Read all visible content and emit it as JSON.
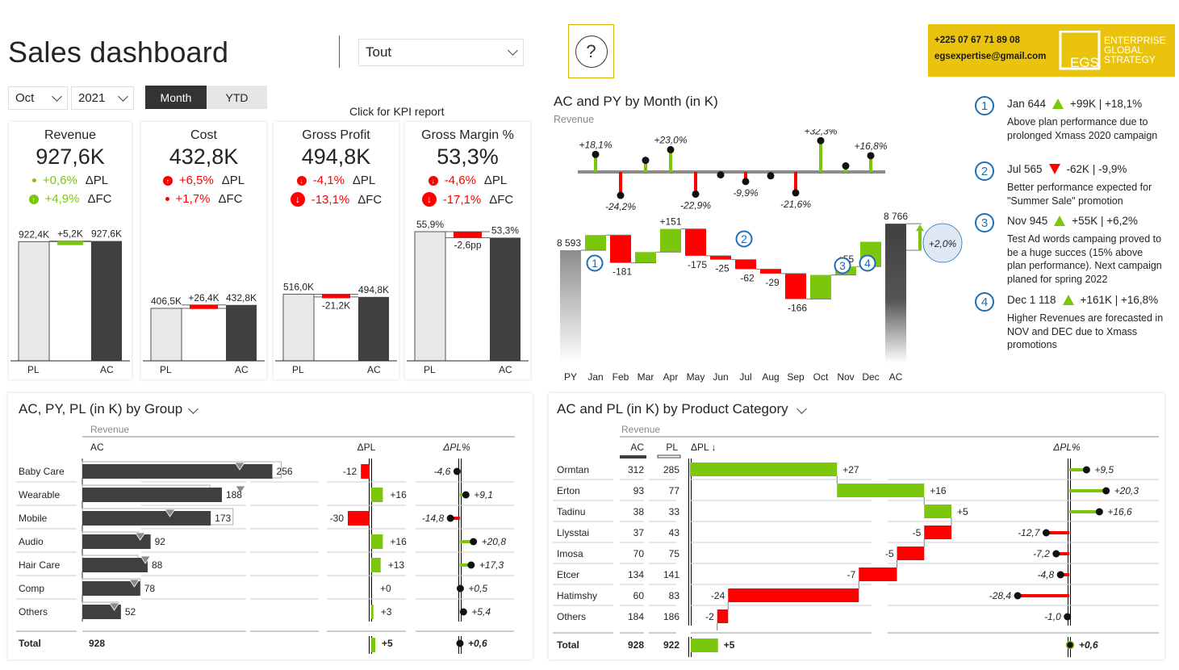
{
  "header": {
    "title": "Sales dashboard",
    "filter_dropdown": "Tout",
    "month_select": "Oct",
    "year_select": "2021",
    "period_toggle": [
      {
        "label": "Month",
        "active": true
      },
      {
        "label": "YTD",
        "active": false
      }
    ],
    "help_icon": "?",
    "kpi_link": "Click for KPI report"
  },
  "brand": {
    "phone": "+225 07 67 71 89 08",
    "email": "egsexpertise@gmail.com",
    "logo_initials": "EGS",
    "logo_line1": "ENTERPRISE",
    "logo_line2": "GLOBAL",
    "logo_line3": "STRATEGY",
    "color": "#EAC30F"
  },
  "colors": {
    "positive": "#7AC70C",
    "negative": "#FF0000",
    "ac": "#404040",
    "pl": "#E8E8E8",
    "annotation": "#1F6EB5"
  },
  "kpi_cards": [
    {
      "title": "Revenue",
      "value": "927,6K",
      "delta_pl": "+0,6%",
      "delta_pl_label": "ΔPL",
      "delta_pl_good": true,
      "delta_pl_icon": "dot-small",
      "delta_fc": "+4,9%",
      "delta_fc_label": "ΔFC",
      "delta_fc_good": true,
      "delta_fc_icon": "arrow-up-circle",
      "chart": {
        "pl": 922.4,
        "ac": 927.6,
        "diff": 5.2,
        "pl_label": "922,4K",
        "ac_label": "927,6K",
        "diff_label": "+5,2K",
        "diff_good": true,
        "scale_max": 1000
      },
      "x_labels": [
        "PL",
        "AC"
      ]
    },
    {
      "title": "Cost",
      "value": "432,8K",
      "delta_pl": "+6,5%",
      "delta_pl_label": "ΔPL",
      "delta_pl_good": false,
      "delta_pl_icon": "arrow-up-circle",
      "delta_fc": "+1,7%",
      "delta_fc_label": "ΔFC",
      "delta_fc_good": false,
      "delta_fc_icon": "dot-small",
      "chart": {
        "pl": 406.5,
        "ac": 432.8,
        "diff": 26.4,
        "pl_label": "406,5K",
        "ac_label": "432,8K",
        "diff_label": "+26,4K",
        "diff_good": false,
        "scale_max": 1000
      },
      "x_labels": [
        "PL",
        "AC"
      ]
    },
    {
      "title": "Gross Profit",
      "value": "494,8K",
      "delta_pl": "-4,1%",
      "delta_pl_label": "ΔPL",
      "delta_pl_good": false,
      "delta_pl_icon": "arrow-down-circle",
      "delta_fc": "-13,1%",
      "delta_fc_label": "ΔFC",
      "delta_fc_good": false,
      "delta_fc_icon": "arrow-down-circle-large",
      "chart": {
        "pl": 516.0,
        "ac": 494.8,
        "diff": -21.2,
        "pl_label": "516,0K",
        "ac_label": "494,8K",
        "diff_label": "-21,2K",
        "diff_good": false,
        "scale_max": 1000
      },
      "x_labels": [
        "PL",
        "AC"
      ]
    },
    {
      "title": "Gross Margin %",
      "value": "53,3%",
      "delta_pl": "-4,6%",
      "delta_pl_label": "ΔPL",
      "delta_pl_good": false,
      "delta_pl_icon": "arrow-down-circle",
      "delta_fc": "-17,1%",
      "delta_fc_label": "ΔFC",
      "delta_fc_good": false,
      "delta_fc_icon": "arrow-down-circle-large",
      "chart": {
        "pl": 55.9,
        "ac": 53.3,
        "diff": -2.6,
        "pl_label": "55,9%",
        "ac_label": "53,3%",
        "diff_label": "-2,6pp",
        "diff_good": false,
        "scale_max": 60
      },
      "x_labels": [
        "PL",
        "AC"
      ]
    }
  ],
  "monthly_chart": {
    "title": "AC and PY by Month (in K)",
    "subtitle": "Revenue",
    "chart_data": {
      "type": "waterfall",
      "categories": [
        "PY",
        "Jan",
        "Feb",
        "Mar",
        "Apr",
        "May",
        "Jun",
        "Jul",
        "Aug",
        "Sep",
        "Oct",
        "Nov",
        "Dec",
        "AC"
      ],
      "py_total": 8593,
      "py_total_label": "8 593",
      "ac_total": 8766,
      "ac_total_label": "8 766",
      "deltas": [
        99,
        -181,
        70,
        151,
        -175,
        -25,
        -62,
        -29,
        -166,
        157,
        55,
        161
      ],
      "delta_labels": [
        "",
        "-181",
        "",
        "+151",
        "-175",
        "-25",
        "-62",
        "-29",
        "-166",
        "",
        "+55",
        ""
      ],
      "delta_pct": [
        18.1,
        -24.2,
        12.0,
        23.0,
        -22.9,
        -3.0,
        -9.9,
        -4.0,
        -21.6,
        32.3,
        6.2,
        16.8
      ],
      "delta_pct_labels": [
        "+18,1%",
        "-24,2%",
        "",
        "+23,0%",
        "-22,9%",
        "",
        "-9,9%",
        "",
        "-21,6%",
        "+32,3%",
        "",
        "+16,8%"
      ],
      "total_change_label": "+2,0%",
      "annotations": [
        {
          "n": "1",
          "month": "Jan"
        },
        {
          "n": "2",
          "month": "Jul"
        },
        {
          "n": "3",
          "month": "Nov"
        },
        {
          "n": "4",
          "month": "Dec"
        }
      ]
    }
  },
  "notes": [
    {
      "n": "1",
      "head": "Jan 644",
      "dir": "up",
      "delta": "+99K | +18,1%",
      "text": "Above plan performance due to prolonged Xmass 2020 campaign"
    },
    {
      "n": "2",
      "head": "Jul 565",
      "dir": "down",
      "delta": "-62K | -9,9%",
      "text": "Better performance expected for \"Summer Sale\" promotion"
    },
    {
      "n": "3",
      "head": "Nov 945",
      "dir": "up",
      "delta": "+55K | +6,2%",
      "text": "Test Ad words campaing proved to be a huge succes (15% above plan performance). Next campaign planed for spring 2022"
    },
    {
      "n": "4",
      "head": "Dec 1 118",
      "dir": "up",
      "delta": "+161K | +16,8%",
      "text": "Higher Revenues are forecasted in NOV and DEC due to Xmass promotions"
    }
  ],
  "group_table": {
    "title": "AC, PY, PL (in K) by Group",
    "subtitle": "Revenue",
    "col_ac": "AC",
    "col_dpl": "ΔPL",
    "col_dplpct": "ΔPL%",
    "total_label": "Total",
    "total_ac": "928",
    "total_dpl": 5,
    "total_dpl_label": "+5",
    "total_dplpct": 0.6,
    "total_dplpct_label": "+0,6",
    "chart_data": {
      "type": "bar",
      "rows": [
        {
          "name": "Baby Care",
          "ac": 256,
          "pl": 268,
          "py": 212,
          "dpl": -12,
          "dpl_label": "-12",
          "dplpct": -4.6,
          "dplpct_label": "-4,6"
        },
        {
          "name": "Wearable",
          "ac": 188,
          "pl": 172,
          "py": 213,
          "dpl": 16,
          "dpl_label": "+16",
          "dplpct": 9.1,
          "dplpct_label": "+9,1"
        },
        {
          "name": "Mobile",
          "ac": 173,
          "pl": 203,
          "py": 118,
          "dpl": -30,
          "dpl_label": "-30",
          "dplpct": -14.8,
          "dplpct_label": "-14,8"
        },
        {
          "name": "Audio",
          "ac": 92,
          "pl": 76,
          "py": 78,
          "dpl": 16,
          "dpl_label": "+16",
          "dplpct": 20.8,
          "dplpct_label": "+20,8"
        },
        {
          "name": "Hair Care",
          "ac": 88,
          "pl": 75,
          "py": 85,
          "dpl": 13,
          "dpl_label": "+13",
          "dplpct": 17.3,
          "dplpct_label": "+17,3"
        },
        {
          "name": "Comp",
          "ac": 78,
          "pl": 78,
          "py": 70,
          "dpl": 0,
          "dpl_label": "+0",
          "dplpct": 0.5,
          "dplpct_label": "+0,5"
        },
        {
          "name": "Others",
          "ac": 52,
          "pl": 49,
          "py": 43,
          "dpl": 3,
          "dpl_label": "+3",
          "dplpct": 5.4,
          "dplpct_label": "+5,4"
        }
      ]
    }
  },
  "category_table": {
    "title": "AC and PL (in K) by Product Category",
    "subtitle": "Revenue",
    "col_ac": "AC",
    "col_pl": "PL",
    "col_dpl": "ΔPL ↓",
    "col_dplpct": "ΔPL%",
    "total_label": "Total",
    "total_ac": "928",
    "total_pl": "922",
    "total_dpl": 5,
    "total_dpl_label": "+5",
    "total_dplpct": 0.6,
    "total_dplpct_label": "+0,6",
    "chart_data": {
      "type": "waterfall",
      "rows": [
        {
          "name": "Ormtan",
          "ac": "312",
          "pl": "285",
          "dpl": 27,
          "dpl_label": "+27",
          "dplpct": 9.5,
          "dplpct_label": "+9,5"
        },
        {
          "name": "Erton",
          "ac": "93",
          "pl": "77",
          "dpl": 16,
          "dpl_label": "+16",
          "dplpct": 20.3,
          "dplpct_label": "+20,3"
        },
        {
          "name": "Tadinu",
          "ac": "38",
          "pl": "33",
          "dpl": 5,
          "dpl_label": "+5",
          "dplpct": 16.6,
          "dplpct_label": "+16,6"
        },
        {
          "name": "Llysstai",
          "ac": "37",
          "pl": "43",
          "dpl": -5,
          "dpl_label": "-5",
          "dplpct": -12.7,
          "dplpct_label": "-12,7"
        },
        {
          "name": "Imosa",
          "ac": "70",
          "pl": "75",
          "dpl": -5,
          "dpl_label": "-5",
          "dplpct": -7.2,
          "dplpct_label": "-7,2"
        },
        {
          "name": "Etcer",
          "ac": "134",
          "pl": "141",
          "dpl": -7,
          "dpl_label": "-7",
          "dplpct": -4.8,
          "dplpct_label": "-4,8"
        },
        {
          "name": "Hatimshy",
          "ac": "60",
          "pl": "83",
          "dpl": -24,
          "dpl_label": "-24",
          "dplpct": -28.4,
          "dplpct_label": "-28,4"
        },
        {
          "name": "Others",
          "ac": "184",
          "pl": "186",
          "dpl": -2,
          "dpl_label": "-2",
          "dplpct": -1.0,
          "dplpct_label": "-1,0"
        }
      ]
    }
  }
}
